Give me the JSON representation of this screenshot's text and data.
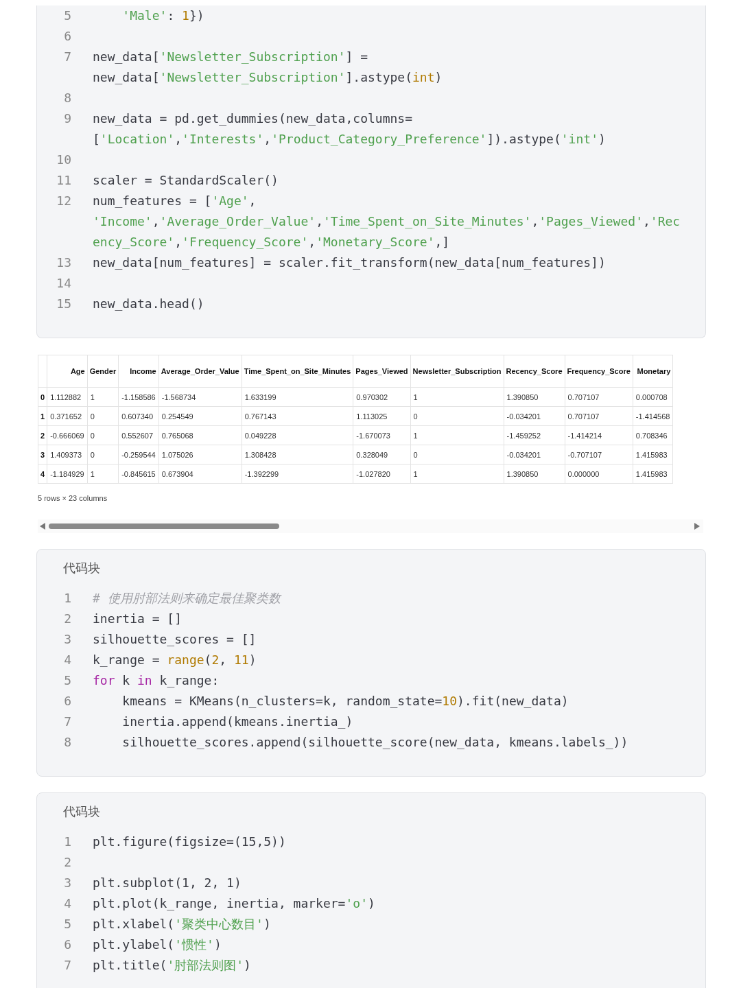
{
  "code_block_top": {
    "lines": [
      {
        "number": "5",
        "rows": [
          {
            "tokens": [
              {
                "kind": "str",
                "text": "    'Male'"
              },
              {
                "kind": "plain",
                "text": ": "
              },
              {
                "kind": "num",
                "text": "1"
              },
              {
                "kind": "plain",
                "text": "})"
              }
            ]
          }
        ]
      },
      {
        "number": "6"
      },
      {
        "number": "7",
        "rows": [
          {
            "tokens": [
              {
                "kind": "plain",
                "text": "new_data["
              },
              {
                "kind": "str",
                "text": "'Newsletter_Subscription'"
              },
              {
                "kind": "plain",
                "text": "] ="
              }
            ]
          },
          {
            "tokens": [
              {
                "kind": "plain",
                "text": "new_data["
              },
              {
                "kind": "str",
                "text": "'Newsletter_Subscription'"
              },
              {
                "kind": "plain",
                "text": "].astype("
              },
              {
                "kind": "num",
                "text": "int"
              },
              {
                "kind": "plain",
                "text": ")"
              }
            ]
          }
        ]
      },
      {
        "number": "8"
      },
      {
        "number": "9",
        "rows": [
          {
            "tokens": [
              {
                "kind": "plain",
                "text": "new_data = pd.get_dummies(new_data,columns="
              }
            ]
          },
          {
            "tokens": [
              {
                "kind": "plain",
                "text": "["
              },
              {
                "kind": "str",
                "text": "'Location'"
              },
              {
                "kind": "plain",
                "text": ","
              },
              {
                "kind": "str",
                "text": "'Interests'"
              },
              {
                "kind": "plain",
                "text": ","
              },
              {
                "kind": "str",
                "text": "'Product_Category_Preference'"
              },
              {
                "kind": "plain",
                "text": "]).astype("
              },
              {
                "kind": "str",
                "text": "'int'"
              },
              {
                "kind": "plain",
                "text": ")"
              }
            ]
          }
        ]
      },
      {
        "number": "10"
      },
      {
        "number": "11",
        "rows": [
          {
            "tokens": [
              {
                "kind": "plain",
                "text": "scaler = StandardScaler()"
              }
            ]
          }
        ]
      },
      {
        "number": "12",
        "rows": [
          {
            "tokens": [
              {
                "kind": "plain",
                "text": "num_features = ["
              },
              {
                "kind": "str",
                "text": "'Age'"
              },
              {
                "kind": "plain",
                "text": ","
              }
            ]
          },
          {
            "tokens": [
              {
                "kind": "str",
                "text": "'Income'"
              },
              {
                "kind": "plain",
                "text": ","
              },
              {
                "kind": "str",
                "text": "'Average_Order_Value'"
              },
              {
                "kind": "plain",
                "text": ","
              },
              {
                "kind": "str",
                "text": "'Time_Spent_on_Site_Minutes'"
              },
              {
                "kind": "plain",
                "text": ","
              },
              {
                "kind": "str",
                "text": "'Pages_Viewed'"
              },
              {
                "kind": "plain",
                "text": ","
              },
              {
                "kind": "str",
                "text": "'Rec"
              }
            ]
          },
          {
            "tokens": [
              {
                "kind": "str",
                "text": "ency_Score'"
              },
              {
                "kind": "plain",
                "text": ","
              },
              {
                "kind": "str",
                "text": "'Frequency_Score'"
              },
              {
                "kind": "plain",
                "text": ","
              },
              {
                "kind": "str",
                "text": "'Monetary_Score'"
              },
              {
                "kind": "plain",
                "text": ",]"
              }
            ]
          }
        ]
      },
      {
        "number": "13",
        "rows": [
          {
            "tokens": [
              {
                "kind": "plain",
                "text": "new_data[num_features] = scaler.fit_transform(new_data[num_features])"
              }
            ]
          }
        ]
      },
      {
        "number": "14"
      },
      {
        "number": "15",
        "rows": [
          {
            "tokens": [
              {
                "kind": "plain",
                "text": "new_data.head()"
              }
            ]
          }
        ]
      }
    ]
  },
  "dataframe": {
    "columns": [
      "Age",
      "Gender",
      "Income",
      "Average_Order_Value",
      "Time_Spent_on_Site_Minutes",
      "Pages_Viewed",
      "Newsletter_Subscription",
      "Recency_Score",
      "Frequency_Score",
      "Monetary"
    ],
    "rows": [
      {
        "index": "0",
        "cells": [
          "1.112882",
          "1",
          "-1.158586",
          "-1.568734",
          "1.633199",
          "0.970302",
          "1",
          "1.390850",
          "0.707107",
          "0.000708"
        ]
      },
      {
        "index": "1",
        "cells": [
          "0.371652",
          "0",
          "0.607340",
          "0.254549",
          "0.767143",
          "1.113025",
          "0",
          "-0.034201",
          "0.707107",
          "-1.414568"
        ]
      },
      {
        "index": "2",
        "cells": [
          "-0.666069",
          "0",
          "0.552607",
          "0.765068",
          "0.049228",
          "-1.670073",
          "1",
          "-1.459252",
          "-1.414214",
          "0.708346"
        ]
      },
      {
        "index": "3",
        "cells": [
          "1.409373",
          "0",
          "-0.259544",
          "1.075026",
          "1.308428",
          "0.328049",
          "0",
          "-0.034201",
          "-0.707107",
          "1.415983"
        ]
      },
      {
        "index": "4",
        "cells": [
          "-1.184929",
          "1",
          "-0.845615",
          "0.673904",
          "-1.392299",
          "-1.027820",
          "1",
          "1.390850",
          "0.000000",
          "1.415983"
        ]
      }
    ],
    "caption": "5 rows × 23 columns"
  },
  "code_blocks": [
    {
      "title": "代码块",
      "lines": [
        {
          "number": "1",
          "rows": [
            {
              "tokens": [
                {
                  "kind": "comment",
                  "text": "# 使用肘部法则来确定最佳聚类数"
                }
              ]
            }
          ]
        },
        {
          "number": "2",
          "rows": [
            {
              "tokens": [
                {
                  "kind": "plain",
                  "text": "inertia = []"
                }
              ]
            }
          ]
        },
        {
          "number": "3",
          "rows": [
            {
              "tokens": [
                {
                  "kind": "plain",
                  "text": "silhouette_scores = []"
                }
              ]
            }
          ]
        },
        {
          "number": "4",
          "rows": [
            {
              "tokens": [
                {
                  "kind": "plain",
                  "text": "k_range = "
                },
                {
                  "kind": "num",
                  "text": "range"
                },
                {
                  "kind": "plain",
                  "text": "("
                },
                {
                  "kind": "num",
                  "text": "2"
                },
                {
                  "kind": "plain",
                  "text": ", "
                },
                {
                  "kind": "num",
                  "text": "11"
                },
                {
                  "kind": "plain",
                  "text": ")"
                }
              ]
            }
          ]
        },
        {
          "number": "5",
          "rows": [
            {
              "tokens": [
                {
                  "kind": "kw",
                  "text": "for"
                },
                {
                  "kind": "plain",
                  "text": " k "
                },
                {
                  "kind": "kw",
                  "text": "in"
                },
                {
                  "kind": "plain",
                  "text": " k_range:"
                }
              ]
            }
          ]
        },
        {
          "number": "6",
          "rows": [
            {
              "tokens": [
                {
                  "kind": "plain",
                  "text": "    kmeans = KMeans(n_clusters=k, random_state="
                },
                {
                  "kind": "num",
                  "text": "10"
                },
                {
                  "kind": "plain",
                  "text": ").fit(new_data)"
                }
              ]
            }
          ]
        },
        {
          "number": "7",
          "rows": [
            {
              "tokens": [
                {
                  "kind": "plain",
                  "text": "    inertia.append(kmeans.inertia_)"
                }
              ]
            }
          ]
        },
        {
          "number": "8",
          "rows": [
            {
              "tokens": [
                {
                  "kind": "plain",
                  "text": "    silhouette_scores.append(silhouette_score(new_data, kmeans.labels_))"
                }
              ]
            }
          ]
        }
      ]
    },
    {
      "title": "代码块",
      "lines": [
        {
          "number": "1",
          "rows": [
            {
              "tokens": [
                {
                  "kind": "plain",
                  "text": "plt.figure(figsize=(15,5))"
                }
              ]
            }
          ]
        },
        {
          "number": "2"
        },
        {
          "number": "3",
          "rows": [
            {
              "tokens": [
                {
                  "kind": "plain",
                  "text": "plt.subplot(1, 2, 1)"
                }
              ]
            }
          ]
        },
        {
          "number": "4",
          "rows": [
            {
              "tokens": [
                {
                  "kind": "plain",
                  "text": "plt.plot(k_range, inertia, marker="
                },
                {
                  "kind": "str",
                  "text": "'o'"
                },
                {
                  "kind": "plain",
                  "text": ")"
                }
              ]
            }
          ]
        },
        {
          "number": "5",
          "rows": [
            {
              "tokens": [
                {
                  "kind": "plain",
                  "text": "plt.xlabel("
                },
                {
                  "kind": "str",
                  "text": "'聚类中心数目'"
                },
                {
                  "kind": "plain",
                  "text": ")"
                }
              ]
            }
          ]
        },
        {
          "number": "6",
          "rows": [
            {
              "tokens": [
                {
                  "kind": "plain",
                  "text": "plt.ylabel("
                },
                {
                  "kind": "str",
                  "text": "'惯性'"
                },
                {
                  "kind": "plain",
                  "text": ")"
                }
              ]
            }
          ]
        },
        {
          "number": "7",
          "rows": [
            {
              "tokens": [
                {
                  "kind": "plain",
                  "text": "plt.title("
                },
                {
                  "kind": "str",
                  "text": "'肘部法则图'"
                },
                {
                  "kind": "plain",
                  "text": ")"
                }
              ]
            }
          ]
        }
      ]
    }
  ]
}
